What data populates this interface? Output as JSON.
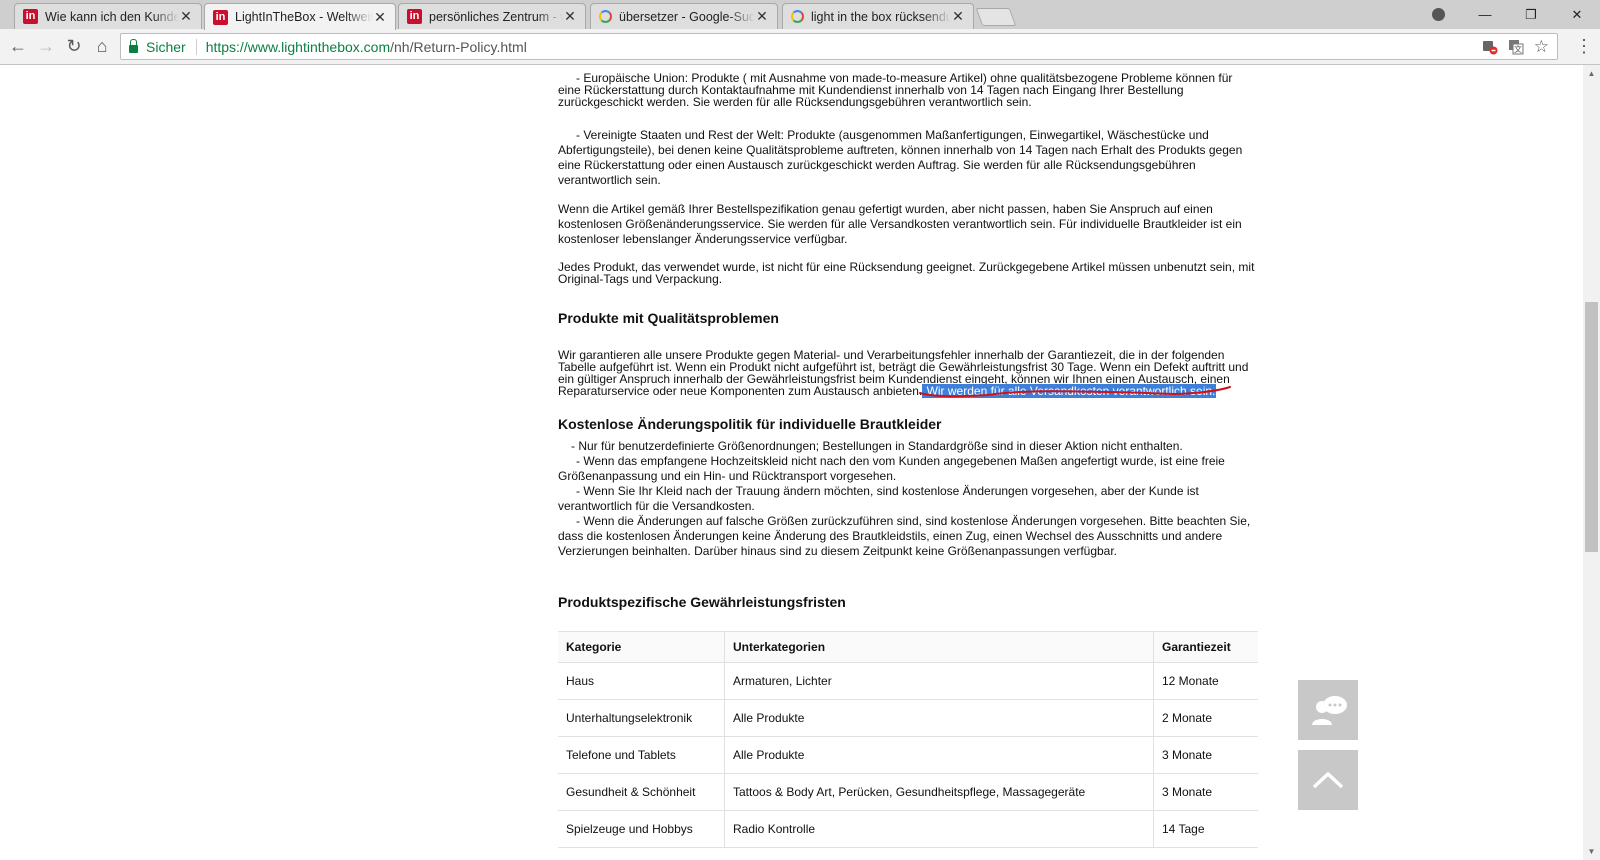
{
  "tabs": [
    {
      "title": "Wie kann ich den Kundendienst",
      "icon": "lightinthebox-favicon-icon",
      "close": "✕"
    },
    {
      "title": "LightInTheBox - Weltweit",
      "icon": "lightinthebox-favicon-icon",
      "close": "✕"
    },
    {
      "title": "persönliches Zentrum - www",
      "icon": "lightinthebox-favicon-icon",
      "close": "✕"
    },
    {
      "title": "übersetzer - Google-Suche",
      "icon": "google-favicon-icon",
      "close": "✕"
    },
    {
      "title": "light in the box rücksendung",
      "icon": "google-favicon-icon",
      "close": "✕"
    }
  ],
  "favicon_letters": {
    "lightinthebox": "in"
  },
  "window_controls": {
    "minimize": "—",
    "restore": "❐",
    "close": "✕"
  },
  "toolbar": {
    "back": "←",
    "forward": "→",
    "reload": "↻",
    "home": "⌂",
    "secure_label": "Sicher",
    "url_scheme": "https://",
    "url_host": "www.lightinthebox.com",
    "url_path": "/nh/Return-Policy.html",
    "star": "☆",
    "menu": "⋮"
  },
  "content": {
    "para_eu": "- Europäische Union: Produkte ( mit Ausnahme  von made-to-measure  Artikel) ohne qualitätsbezogene Probleme können für eine Rückerstattung durch Kontaktaufnahme mit Kundendienst innerhalb von 14 Tagen nach Eingang Ihrer Bestellung zurückgeschickt werden. Sie werden für alle Rücksendungsgebühren verantwortlich sein.",
    "para_us": "- Vereinigte Staaten und Rest der Welt: Produkte (ausgenommen Maßanfertigungen, Einwegartikel, Wäschestücke und Abfertigungsteile), bei denen keine Qualitätsprobleme auftreten, können innerhalb von 14 Tagen nach Erhalt des Produkts gegen eine Rückerstattung oder einen Austausch zurückgeschickt werden Auftrag. Sie werden für alle Rücksendungsgebühren verantwortlich sein.",
    "para_size": "Wenn die Artikel gemäß Ihrer Bestellspezifikation genau gefertigt wurden, aber nicht passen, haben Sie Anspruch auf einen kostenlosen Größenänderungsservice. Sie werden für alle Versandkosten verantwortlich sein. Für individuelle Brautkleider ist ein kostenloser lebenslanger Änderungsservice verfügbar.",
    "para_used": "Jedes Produkt, das verwendet wurde, ist nicht für eine Rücksendung geeignet. Zurückgegebene Artikel müssen unbenutzt sein, mit Original-Tags und Verpackung.",
    "heading_quality": "Produkte mit Qualitätsproblemen",
    "para_quality": "Wir garantieren alle unsere Produkte gegen Material- und Verarbeitungsfehler innerhalb der Garantiezeit, die in der folgenden Tabelle aufgeführt ist. Wenn ein Produkt nicht aufgeführt ist, beträgt die Gewährleistungsfrist 30 Tage. Wenn ein Defekt auftritt und ein gültiger Anspruch innerhalb der Gewährleistungsfrist beim Kundendienst eingeht, können wir Ihnen einen Austausch, einen Reparaturservice oder neue Komponenten zum Austausch anbieten.",
    "para_quality_highlight": " Wir werden für alle Versandkosten verantwortlich sein.",
    "heading_alteration": "Kostenlose Änderungspolitik für individuelle Brautkleider",
    "bullets_alteration": [
      "- Nur für benutzerdefinierte Größenordnungen; Bestellungen in Standardgröße sind in dieser Aktion nicht enthalten.",
      "- Wenn das empfangene Hochzeitskleid nicht nach den vom Kunden angegebenen Maßen angefertigt wurde, ist eine freie Größenanpassung und ein Hin- und Rücktransport vorgesehen.",
      "- Wenn Sie Ihr Kleid nach der Trauung ändern möchten, sind kostenlose Änderungen vorgesehen, aber der Kunde ist verantwortlich für die Versandkosten.",
      "- Wenn die Änderungen auf falsche Größen zurückzuführen sind, sind kostenlose Änderungen vorgesehen. Bitte beachten Sie, dass die kostenlosen Änderungen keine Änderung des Brautkleidstils, einen Zug, einen Wechsel des Ausschnitts und andere Verzierungen beinhalten. Darüber hinaus sind zu diesem Zeitpunkt keine Größenanpassungen verfügbar."
    ],
    "heading_warranty": "Produktspezifische Gewährleistungsfristen",
    "table_headers": [
      "Kategorie",
      "Unterkategorien",
      "Garantiezeit"
    ],
    "table_rows": [
      [
        "Haus",
        "Armaturen, Lichter",
        "12 Monate"
      ],
      [
        "Unterhaltungselektronik",
        "Alle Produkte",
        "2 Monate"
      ],
      [
        "Telefone und Tablets",
        "Alle Produkte",
        "3 Monate"
      ],
      [
        "Gesundheit & Schönheit",
        "Tattoos & Body Art, Perücken, Gesundheitspflege, Massagegeräte",
        "3 Monate"
      ],
      [
        "Spielzeuge und Hobbys",
        "Radio Kontrolle",
        "14 Tage"
      ]
    ]
  },
  "colors": {
    "highlight": "#3d7fd9",
    "annotation": "#d0121b",
    "secure": "#0b8043",
    "brand": "#c8102e"
  }
}
